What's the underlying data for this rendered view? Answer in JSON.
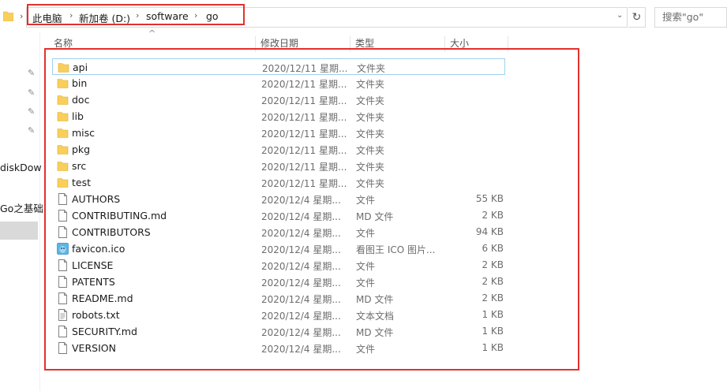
{
  "address": {
    "crumbs": [
      "此电脑",
      "新加卷 (D:)",
      "software",
      "go"
    ],
    "search_placeholder": "搜索\"go\""
  },
  "columns": {
    "name": "名称",
    "date": "修改日期",
    "type": "类型",
    "size": "大小"
  },
  "nav": {
    "items": [
      "diskDow",
      "Go之基础"
    ]
  },
  "colors": {
    "highlight": "#e3312d",
    "folder": "#f8cf5b",
    "selected_row_border": "#9fd0f0"
  },
  "files": [
    {
      "name": "api",
      "date": "2020/12/11 星期...",
      "type": "文件夹",
      "size": "",
      "icon": "folder-icon"
    },
    {
      "name": "bin",
      "date": "2020/12/11 星期...",
      "type": "文件夹",
      "size": "",
      "icon": "folder-icon"
    },
    {
      "name": "doc",
      "date": "2020/12/11 星期...",
      "type": "文件夹",
      "size": "",
      "icon": "folder-icon"
    },
    {
      "name": "lib",
      "date": "2020/12/11 星期...",
      "type": "文件夹",
      "size": "",
      "icon": "folder-icon"
    },
    {
      "name": "misc",
      "date": "2020/12/11 星期...",
      "type": "文件夹",
      "size": "",
      "icon": "folder-icon"
    },
    {
      "name": "pkg",
      "date": "2020/12/11 星期...",
      "type": "文件夹",
      "size": "",
      "icon": "folder-icon"
    },
    {
      "name": "src",
      "date": "2020/12/11 星期...",
      "type": "文件夹",
      "size": "",
      "icon": "folder-icon"
    },
    {
      "name": "test",
      "date": "2020/12/11 星期...",
      "type": "文件夹",
      "size": "",
      "icon": "folder-icon"
    },
    {
      "name": "AUTHORS",
      "date": "2020/12/4 星期...",
      "type": "文件",
      "size": "55 KB",
      "icon": "file-icon"
    },
    {
      "name": "CONTRIBUTING.md",
      "date": "2020/12/4 星期...",
      "type": "MD 文件",
      "size": "2 KB",
      "icon": "file-icon"
    },
    {
      "name": "CONTRIBUTORS",
      "date": "2020/12/4 星期...",
      "type": "文件",
      "size": "94 KB",
      "icon": "file-icon"
    },
    {
      "name": "favicon.ico",
      "date": "2020/12/4 星期...",
      "type": "看图王 ICO 图片...",
      "size": "6 KB",
      "icon": "image-icon"
    },
    {
      "name": "LICENSE",
      "date": "2020/12/4 星期...",
      "type": "文件",
      "size": "2 KB",
      "icon": "file-icon"
    },
    {
      "name": "PATENTS",
      "date": "2020/12/4 星期...",
      "type": "文件",
      "size": "2 KB",
      "icon": "file-icon"
    },
    {
      "name": "README.md",
      "date": "2020/12/4 星期...",
      "type": "MD 文件",
      "size": "2 KB",
      "icon": "file-icon"
    },
    {
      "name": "robots.txt",
      "date": "2020/12/4 星期...",
      "type": "文本文档",
      "size": "1 KB",
      "icon": "text-file-icon"
    },
    {
      "name": "SECURITY.md",
      "date": "2020/12/4 星期...",
      "type": "MD 文件",
      "size": "1 KB",
      "icon": "file-icon"
    },
    {
      "name": "VERSION",
      "date": "2020/12/4 星期...",
      "type": "文件",
      "size": "1 KB",
      "icon": "file-icon"
    }
  ]
}
